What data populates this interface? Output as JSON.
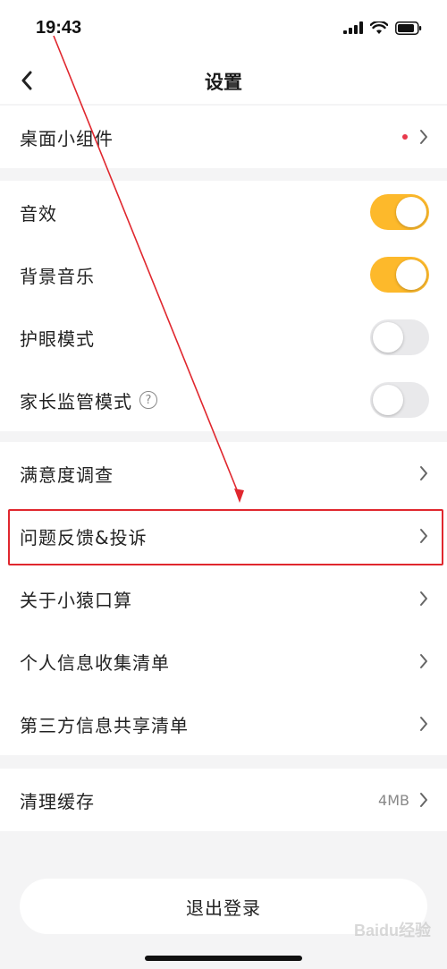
{
  "status_bar": {
    "time": "19:43"
  },
  "nav": {
    "title": "设置"
  },
  "group1": [
    {
      "label": "桌面小组件",
      "has_dot": true
    }
  ],
  "group2": [
    {
      "label": "音效",
      "toggle": "on"
    },
    {
      "label": "背景音乐",
      "toggle": "on"
    },
    {
      "label": "护眼模式",
      "toggle": "off"
    },
    {
      "label": "家长监管模式",
      "toggle": "off",
      "help_icon": "?"
    }
  ],
  "group3": [
    {
      "label": "满意度调查"
    },
    {
      "label": "问题反馈&投诉",
      "highlighted": true
    },
    {
      "label": "关于小猿口算"
    },
    {
      "label": "个人信息收集清单"
    },
    {
      "label": "第三方信息共享清单"
    }
  ],
  "group4": [
    {
      "label": "清理缓存",
      "value": "4MB"
    }
  ],
  "logout": {
    "label": "退出登录"
  },
  "watermark": "Baidu经验",
  "colors": {
    "accent_toggle": "#fdb92b",
    "notify_dot": "#e8384b",
    "annotation_red": "#e0272e"
  }
}
